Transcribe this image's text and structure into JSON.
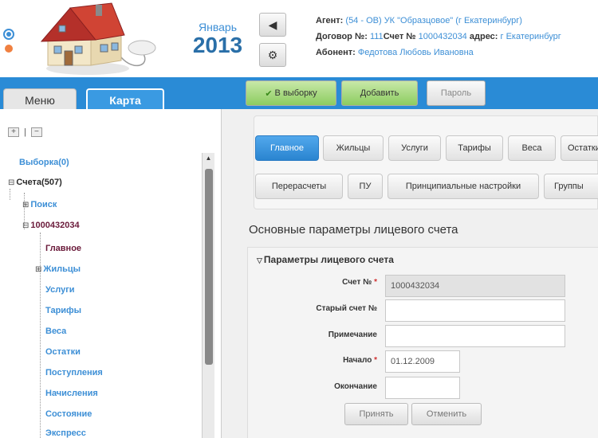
{
  "header": {
    "month": "Январь",
    "year": "2013",
    "nav_prev_icon": "triangle-left-icon",
    "settings_icon": "gear-icon",
    "info": {
      "agent_label": "Агент:",
      "agent_value": "(54 - ОВ) УК \"Образцовое\" (г Екатеринбург)",
      "contract_label": "Договор №:",
      "contract_value": "111",
      "account_label": "Счет №",
      "account_value": "1000432034",
      "address_label": "адрес:",
      "address_value": "г Екатеринбург",
      "subscriber_label": "Абонент:",
      "subscriber_value": "Федотова Любовь Ивановна"
    }
  },
  "left": {
    "tabs": {
      "menu": "Меню",
      "karta": "Карта"
    },
    "tree_controls": {
      "expand": "+",
      "separator": "|",
      "collapse": "−"
    },
    "tree": {
      "vyborka": "Выборка(0)",
      "scheta": "Счета(507)",
      "poisk": "Поиск",
      "account": "1000432034",
      "items": [
        "Главное",
        "Жильцы",
        "Услуги",
        "Тарифы",
        "Веса",
        "Остатки",
        "Поступления",
        "Начисления",
        "Состояние",
        "Экспресс"
      ]
    }
  },
  "toolbar": {
    "to_selection": "В выборку",
    "add": "Добавить",
    "password": "Пароль"
  },
  "page_tabs": {
    "row1": [
      "Главное",
      "Жильцы",
      "Услуги",
      "Тарифы",
      "Веса",
      "Остатки"
    ],
    "row2": [
      "Перерасчеты",
      "ПУ",
      "Принципиальные настройки",
      "Группы"
    ]
  },
  "section_title": "Основные параметры лицевого счета",
  "form": {
    "legend": "Параметры лицевого счета",
    "account_label": "Счет №",
    "account_value": "1000432034",
    "old_account_label": "Старый счет №",
    "note_label": "Примечание",
    "start_label": "Начало",
    "start_value": "01.12.2009",
    "end_label": "Окончание",
    "required_mark": "*",
    "apply": "Принять",
    "cancel": "Отменить"
  },
  "colors": {
    "accent": "#2a8bd6",
    "link": "#3d8fd6",
    "tree_dark": "#6a1a3a",
    "green_button": "#8ccc60"
  }
}
